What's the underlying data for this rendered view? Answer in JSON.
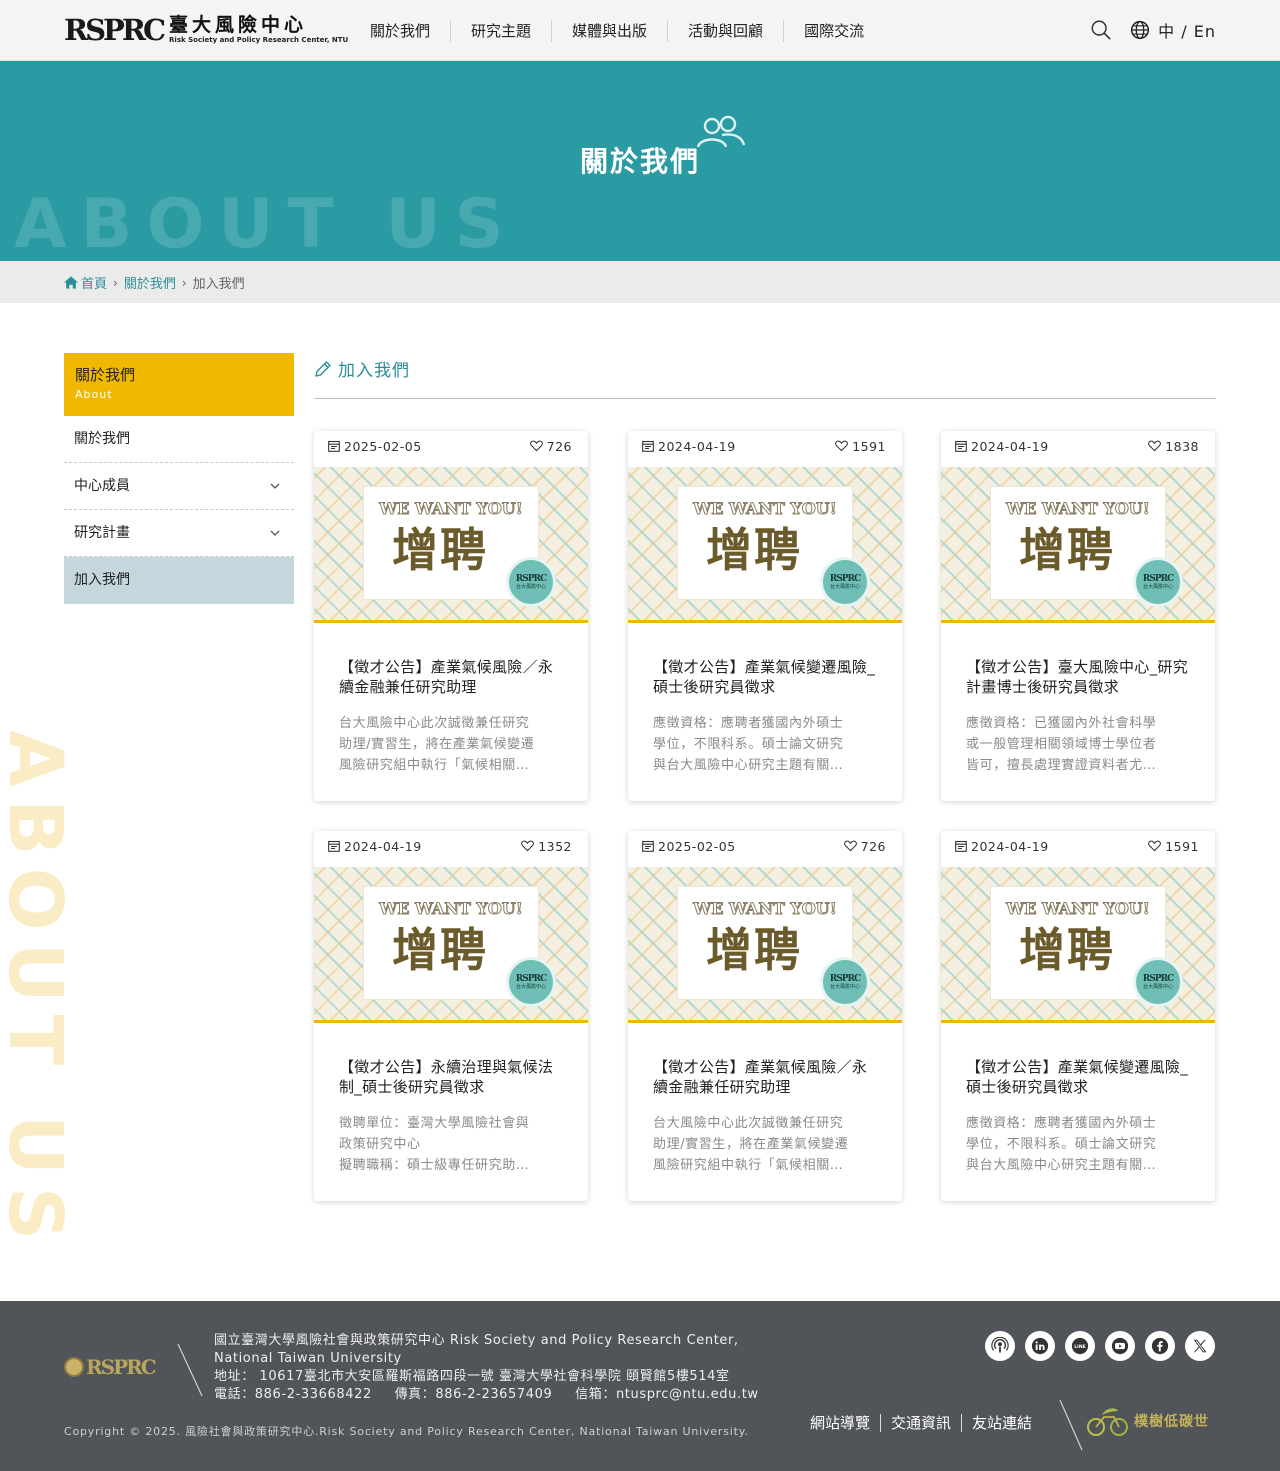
{
  "header": {
    "logo_mark": "RSPRC",
    "logo_cn": "臺大風險中心",
    "logo_en": "Risk Society and Policy Research Center, NTU",
    "nav": [
      "關於我們",
      "研究主題",
      "媒體與出版",
      "活動與回顧",
      "國際交流"
    ],
    "lang": "中 / En"
  },
  "banner": {
    "title": "關於我們",
    "watermark": "ABOUT US"
  },
  "breadcrumb": {
    "home": "首頁",
    "parent": "關於我們",
    "current": "加入我們"
  },
  "side_watermark": "ABOUT US",
  "sidebar": {
    "head_title": "關於我們",
    "head_sub": "About",
    "items": [
      {
        "label": "關於我們"
      },
      {
        "label": "中心成員"
      },
      {
        "label": "研究計畫"
      },
      {
        "label": "加入我們"
      }
    ]
  },
  "main": {
    "section_title": "加入我們"
  },
  "poster": {
    "tag": "WE WANT YOU!",
    "main": "增聘",
    "seal": "RSPRC",
    "seal_sub": "台大風險中心"
  },
  "cards": [
    {
      "date": "2025-02-05",
      "likes": "726",
      "title": "【徵才公告】產業氣候風險／永續金融兼任研究助理",
      "desc": "台大風險中心此次誠徵兼任研究\n助理/實習生，將在產業氣候變遷\n風險研究組中執行「氣候相關…"
    },
    {
      "date": "2024-04-19",
      "likes": "1591",
      "title": "【徵才公告】產業氣候變遷風險_碩士後研究員徵求",
      "desc": "應徵資格：應聘者獲國內外碩士\n學位，不限科系。碩士論文研究\n與台大風險中心研究主題有關…"
    },
    {
      "date": "2024-04-19",
      "likes": "1838",
      "title": "【徵才公告】臺大風險中心_研究計畫博士後研究員徵求",
      "desc": "應徵資格：已獲國內外社會科學\n或一般管理相關領域博士學位者\n皆可，擅長處理實證資料者尤…"
    },
    {
      "date": "2024-04-19",
      "likes": "1352",
      "title": "【徵才公告】永續治理與氣候法制_碩士後研究員徵求",
      "desc": "徵聘單位：臺灣大學風險社會與\n政策研究中心\n擬聘職稱：碩士級專任研究助…"
    },
    {
      "date": "2025-02-05",
      "likes": "726",
      "title": "【徵才公告】產業氣候風險／永續金融兼任研究助理",
      "desc": "台大風險中心此次誠徵兼任研究\n助理/實習生，將在產業氣候變遷\n風險研究組中執行「氣候相關…"
    },
    {
      "date": "2024-04-19",
      "likes": "1591",
      "title": "【徵才公告】產業氣候變遷風險_碩士後研究員徵求",
      "desc": "應徵資格：應聘者獲國內外碩士\n學位，不限科系。碩士論文研究\n與台大風險中心研究主題有關…"
    }
  ],
  "footer": {
    "logo_mark": "RSPRC",
    "org_line1": "國立臺灣大學風險社會與政策研究中心 Risk Society and Policy Research Center,",
    "org_line2": "National Taiwan University",
    "address": "地址： 10617臺北市大安區羅斯福路四段一號 臺灣大學社會科學院 頤賢館5樓514室",
    "phone": "電話：886-2-33668422",
    "fax": "傳真：886-2-23657409",
    "email": "信箱：ntusprc@ntu.edu.tw",
    "copyright": "Copyright © 2025. 風險社會與政策研究中心.Risk Society and Policy Research Center, National Taiwan University.",
    "links": [
      "網站導覽",
      "交通資訊",
      "友站連結"
    ],
    "eco_label": "樸樹低碳世",
    "social_icons": [
      "podcast-icon",
      "linkedin-icon",
      "line-icon",
      "youtube-icon",
      "facebook-icon",
      "x-icon"
    ]
  },
  "colors": {
    "teal": "#2b9ba3",
    "gold": "#f0b800",
    "active_side": "#c5d7dc",
    "footer": "#515459"
  }
}
